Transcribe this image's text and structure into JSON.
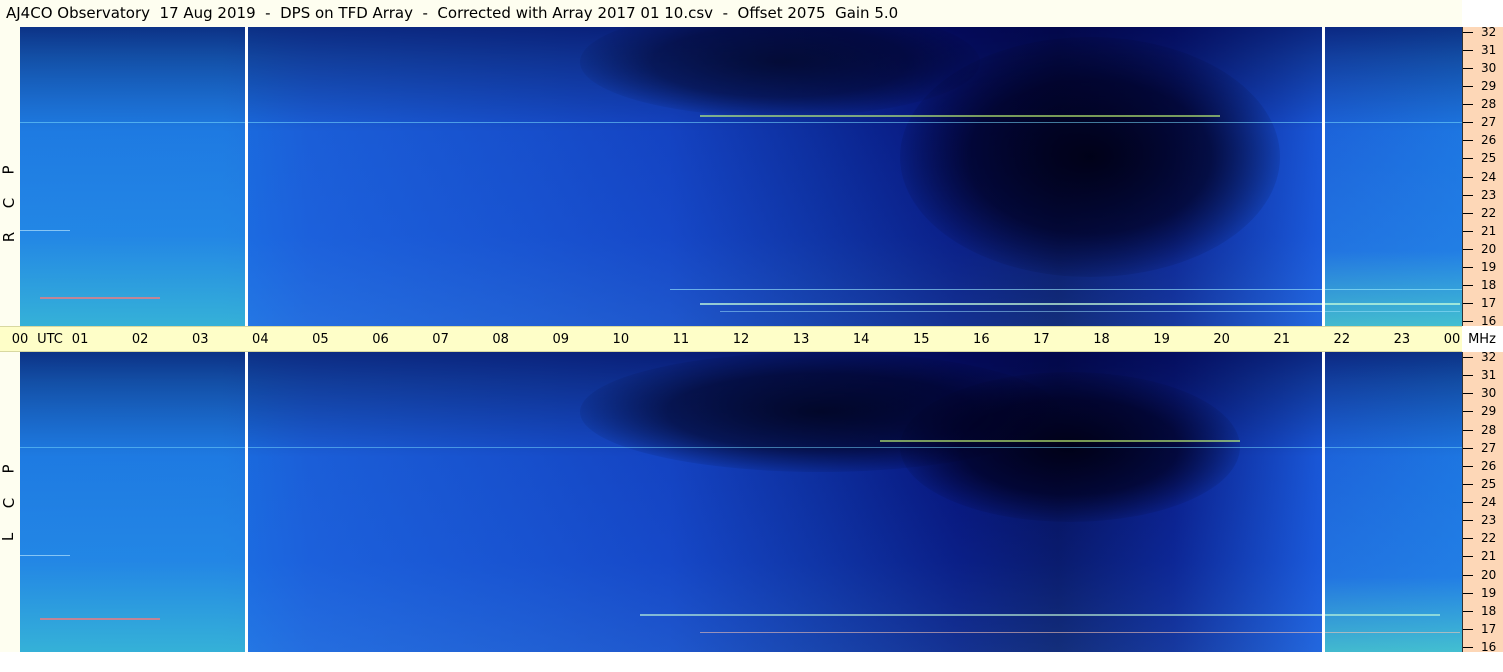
{
  "title": "AJ4CO Observatory  17 Aug 2019  -  DPS on TFD Array  -  Corrected with Array 2017 01 10.csv  -  Offset 2075  Gain 5.0",
  "panels": {
    "top": {
      "polarization": [
        "R",
        "C",
        "P"
      ]
    },
    "bottom": {
      "polarization": [
        "L",
        "C",
        "P"
      ]
    }
  },
  "time_axis": {
    "start_label": "00",
    "unit_label": "UTC",
    "hours": [
      "01",
      "02",
      "03",
      "04",
      "05",
      "06",
      "07",
      "08",
      "09",
      "10",
      "11",
      "12",
      "13",
      "14",
      "15",
      "16",
      "17",
      "18",
      "19",
      "20",
      "21",
      "22",
      "23"
    ],
    "end_label": "00",
    "end_unit": "MHz"
  },
  "freq_axis": {
    "labels": [
      "32",
      "31",
      "30",
      "29",
      "28",
      "27",
      "26",
      "25",
      "24",
      "23",
      "22",
      "21",
      "20",
      "19",
      "18",
      "17",
      "16"
    ]
  },
  "colors": {
    "title_bg": "#fefef0",
    "time_bar_bg": "#fefec8",
    "freq_axis_bg": "#fdd7b7",
    "spectro_base": "#1a6fe0",
    "spectro_dark": "#06115e"
  }
}
